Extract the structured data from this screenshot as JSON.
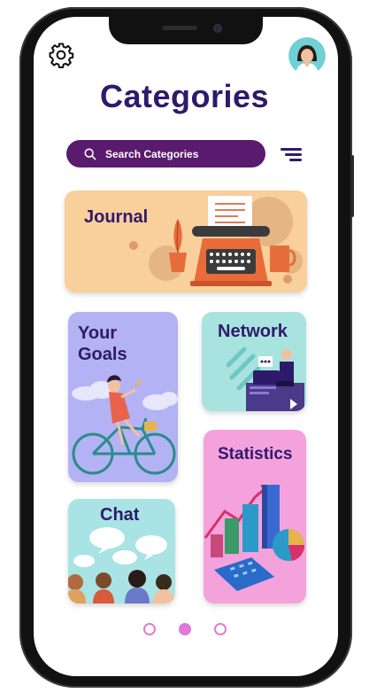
{
  "header": {
    "title": "Categories"
  },
  "search": {
    "placeholder": "Search Categories"
  },
  "cards": {
    "journal": "Journal",
    "goals_line1": "Your",
    "goals_line2": "Goals",
    "network": "Network",
    "chat": "Chat",
    "statistics": "Statistics"
  },
  "pagination": {
    "active_page": 2,
    "total_pages": 3
  },
  "colors": {
    "title": "#2e1a6b",
    "search_bg": "#5a1a6e",
    "journal_bg": "#f9cf9c",
    "goals_bg": "#b3b2f4",
    "network_bg": "#a8e3df",
    "chat_bg": "#a9e3e4",
    "statistics_bg": "#f3a2dc",
    "dot": "#e07ad8"
  },
  "icons": [
    "gear-icon",
    "avatar",
    "search-icon",
    "filter-icon"
  ]
}
